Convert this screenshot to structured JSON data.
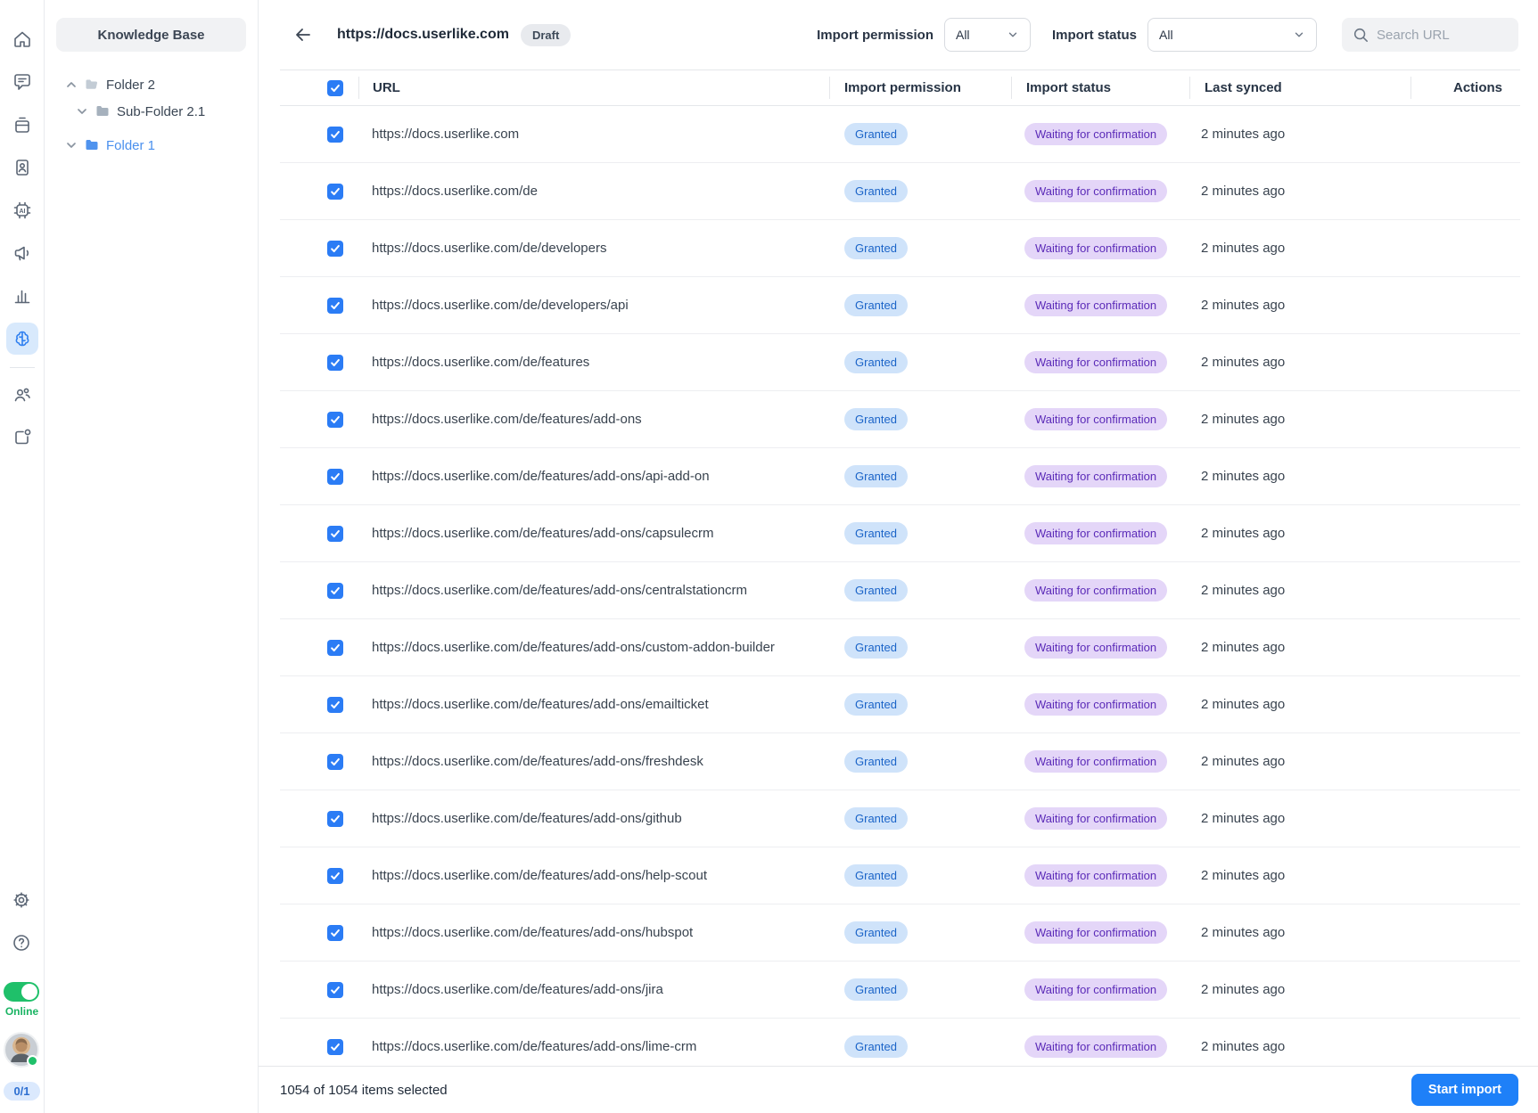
{
  "rail": {
    "items": [
      {
        "name": "home",
        "active": false
      },
      {
        "name": "conversations",
        "active": false
      },
      {
        "name": "inbox",
        "active": false
      },
      {
        "name": "contacts",
        "active": false
      },
      {
        "name": "ai-automation",
        "active": false
      },
      {
        "name": "campaigns",
        "active": false
      },
      {
        "name": "analytics",
        "active": false
      },
      {
        "name": "knowledge-base",
        "active": true
      },
      {
        "name": "team",
        "active": false
      },
      {
        "name": "integrations",
        "active": false
      },
      {
        "name": "settings",
        "active": false
      },
      {
        "name": "help",
        "active": false
      }
    ],
    "online_label": "Online",
    "counter": "0/1"
  },
  "sidebar": {
    "title": "Knowledge Base",
    "tree": [
      {
        "label": "Folder 2",
        "level": 0,
        "chevron": "up",
        "selected": false
      },
      {
        "label": "Sub-Folder 2.1",
        "level": 1,
        "chevron": "down",
        "selected": false
      },
      {
        "label": "Folder 1",
        "level": 0,
        "chevron": "down",
        "selected": true
      }
    ]
  },
  "header": {
    "title": "https://docs.userlike.com",
    "badge": "Draft",
    "filters": {
      "permission": {
        "label": "Import permission",
        "value": "All"
      },
      "status": {
        "label": "Import status",
        "value": "All"
      }
    },
    "search_placeholder": "Search URL"
  },
  "table": {
    "columns": [
      "URL",
      "Import permission",
      "Import status",
      "Last synced",
      "Actions"
    ],
    "rows": [
      {
        "url": "https://docs.userlike.com",
        "permission": "Granted",
        "status": "Waiting for confirmation",
        "synced": "2 minutes ago"
      },
      {
        "url": "https://docs.userlike.com/de",
        "permission": "Granted",
        "status": "Waiting for confirmation",
        "synced": "2 minutes ago"
      },
      {
        "url": "https://docs.userlike.com/de/developers",
        "permission": "Granted",
        "status": "Waiting for confirmation",
        "synced": "2 minutes ago"
      },
      {
        "url": "https://docs.userlike.com/de/developers/api",
        "permission": "Granted",
        "status": "Waiting for confirmation",
        "synced": "2 minutes ago"
      },
      {
        "url": "https://docs.userlike.com/de/features",
        "permission": "Granted",
        "status": "Waiting for confirmation",
        "synced": "2 minutes ago"
      },
      {
        "url": "https://docs.userlike.com/de/features/add-ons",
        "permission": "Granted",
        "status": "Waiting for confirmation",
        "synced": "2 minutes ago"
      },
      {
        "url": "https://docs.userlike.com/de/features/add-ons/api-add-on",
        "permission": "Granted",
        "status": "Waiting for confirmation",
        "synced": "2 minutes ago"
      },
      {
        "url": "https://docs.userlike.com/de/features/add-ons/capsulecrm",
        "permission": "Granted",
        "status": "Waiting for confirmation",
        "synced": "2 minutes ago"
      },
      {
        "url": "https://docs.userlike.com/de/features/add-ons/centralstationcrm",
        "permission": "Granted",
        "status": "Waiting for confirmation",
        "synced": "2 minutes ago"
      },
      {
        "url": "https://docs.userlike.com/de/features/add-ons/custom-addon-builder",
        "permission": "Granted",
        "status": "Waiting for confirmation",
        "synced": "2 minutes ago"
      },
      {
        "url": "https://docs.userlike.com/de/features/add-ons/emailticket",
        "permission": "Granted",
        "status": "Waiting for confirmation",
        "synced": "2 minutes ago"
      },
      {
        "url": "https://docs.userlike.com/de/features/add-ons/freshdesk",
        "permission": "Granted",
        "status": "Waiting for confirmation",
        "synced": "2 minutes ago"
      },
      {
        "url": "https://docs.userlike.com/de/features/add-ons/github",
        "permission": "Granted",
        "status": "Waiting for confirmation",
        "synced": "2 minutes ago"
      },
      {
        "url": "https://docs.userlike.com/de/features/add-ons/help-scout",
        "permission": "Granted",
        "status": "Waiting for confirmation",
        "synced": "2 minutes ago"
      },
      {
        "url": "https://docs.userlike.com/de/features/add-ons/hubspot",
        "permission": "Granted",
        "status": "Waiting for confirmation",
        "synced": "2 minutes ago"
      },
      {
        "url": "https://docs.userlike.com/de/features/add-ons/jira",
        "permission": "Granted",
        "status": "Waiting for confirmation",
        "synced": "2 minutes ago"
      },
      {
        "url": "https://docs.userlike.com/de/features/add-ons/lime-crm",
        "permission": "Granted",
        "status": "Waiting for confirmation",
        "synced": "2 minutes ago"
      }
    ]
  },
  "footer": {
    "selection": "1054 of 1054 items selected",
    "button": "Start import"
  },
  "colors": {
    "accent_blue": "#1e80f8",
    "checkbox_blue": "#2b7cf5",
    "granted_bg": "#cfe3fa",
    "granted_text": "#1b64c8",
    "waiting_bg": "#e4d6f8",
    "waiting_text": "#5b2bb8",
    "online_green": "#1fc06a",
    "active_rail_bg": "#d8e9fc",
    "draft_bg": "#e8eaee"
  }
}
